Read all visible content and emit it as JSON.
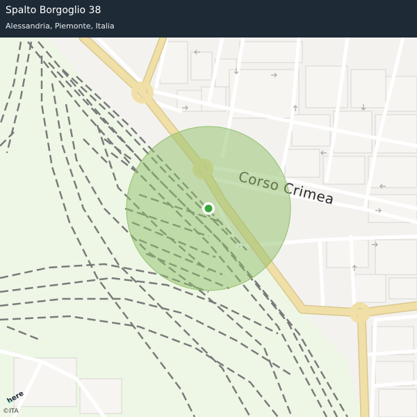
{
  "header": {
    "title": "Spalto Borgoglio 38",
    "subtitle": "Alessandria, Piemonte, Italia"
  },
  "map": {
    "street_label": "Corso  Crimea",
    "logo_text": "here",
    "copyright": "©ITA",
    "colors": {
      "background": "#f4f2ef",
      "header": "#1e2a36",
      "park": "#eef7e6",
      "road_major": "#f0dfa6",
      "road_major_casing": "#d9c890",
      "street": "#ffffff",
      "street_casing": "#cfcdca",
      "rail": "#7a7a7a",
      "accuracy_circle": "#8fbf6a",
      "location_dot": "#3aa53a"
    }
  }
}
